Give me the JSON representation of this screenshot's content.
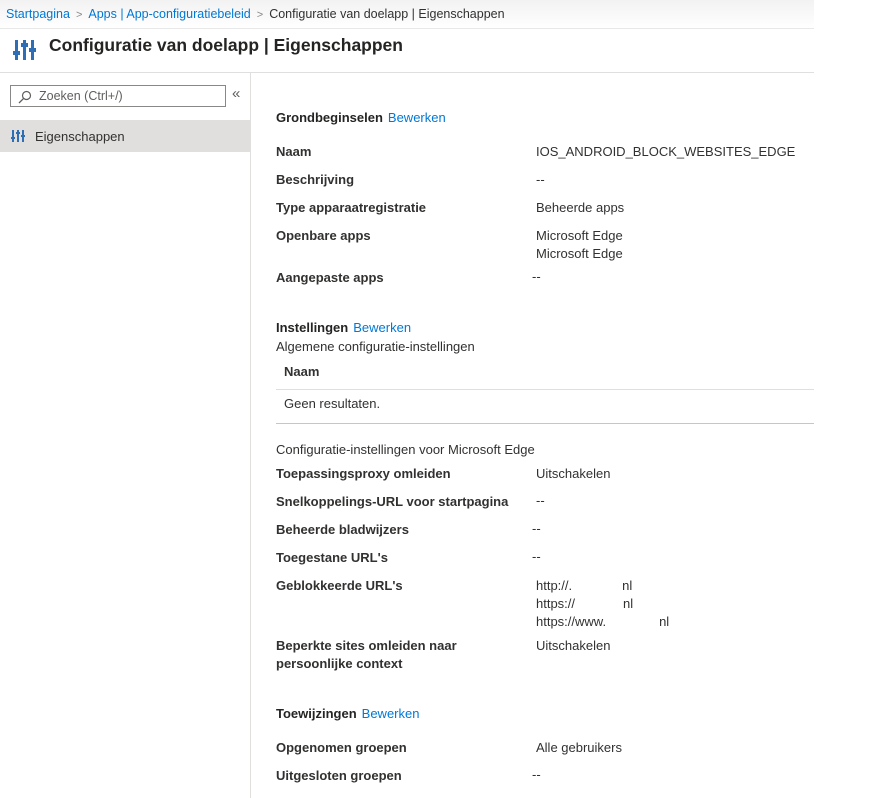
{
  "breadcrumb": {
    "home": "Startpagina",
    "apps": "Apps | App-configuratiebeleid",
    "current": "Configuratie van doelapp | Eigenschappen"
  },
  "header": {
    "title": "Configuratie van doelapp | Eigenschappen",
    "icon": "settings-sliders-icon"
  },
  "sidebar": {
    "search_placeholder": "Zoeken (Ctrl+/)",
    "collapse": "«",
    "items": [
      {
        "label": "Eigenschappen",
        "icon": "properties-sliders-icon",
        "selected": true
      }
    ]
  },
  "basics": {
    "title": "Grondbeginselen",
    "edit": "Bewerken",
    "rows": [
      {
        "label": "Naam",
        "value": "IOS_ANDROID_BLOCK_WEBSITES_EDGE"
      },
      {
        "label": "Beschrijving",
        "value": "--"
      },
      {
        "label": "Type apparaatregistratie",
        "value": "Beheerde apps"
      },
      {
        "label": "Openbare apps",
        "values": [
          "Microsoft Edge",
          "Microsoft Edge"
        ]
      },
      {
        "label": "Aangepaste apps",
        "value": "--"
      }
    ]
  },
  "settings": {
    "title": "Instellingen",
    "edit": "Bewerken",
    "general_title": "Algemene configuratie-instellingen",
    "grid_header": "Naam",
    "grid_empty": "Geen resultaten.",
    "edge_title": "Configuratie-instellingen voor Microsoft Edge",
    "rows": [
      {
        "label": "Toepassingsproxy omleiden",
        "value": "Uitschakelen"
      },
      {
        "label": "Snelkoppelings-URL voor startpagina",
        "value": "--"
      },
      {
        "label": "Beheerde bladwijzers",
        "value": "--"
      },
      {
        "label": "Toegestane URL's",
        "value": "--"
      },
      {
        "label": "Geblokkeerde URL's",
        "values": [
          {
            "prefix": "http://.",
            "suffix": "nl"
          },
          {
            "prefix": "https://",
            "suffix": "nl"
          },
          {
            "prefix": "https://www.",
            "suffix": "nl"
          }
        ]
      },
      {
        "label": "Beperkte sites omleiden naar persoonlijke context",
        "value": "Uitschakelen"
      }
    ]
  },
  "assignments": {
    "title": "Toewijzingen",
    "edit": "Bewerken",
    "rows": [
      {
        "label": "Opgenomen groepen",
        "value": "Alle gebruikers"
      },
      {
        "label": "Uitgesloten groepen",
        "value": "--"
      }
    ]
  },
  "colors": {
    "link": "#0078d4",
    "text": "#323130",
    "selected_bg": "#e1dfdd",
    "icon_blue": "#2f6db5"
  }
}
